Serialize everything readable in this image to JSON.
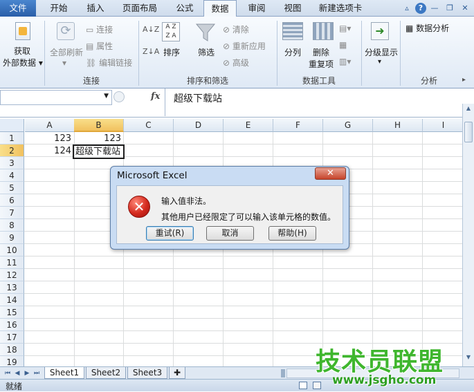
{
  "ribbon_tabs": [
    "文件",
    "开始",
    "插入",
    "页面布局",
    "公式",
    "数据",
    "审阅",
    "视图",
    "新建选项卡"
  ],
  "active_tab": "数据",
  "ribbon": {
    "get_external": [
      "获取",
      "外部数据"
    ],
    "refresh_all": "全部刷新",
    "connections": "连接",
    "properties": "属性",
    "edit_links": "编辑链接",
    "group_connections": "连接",
    "sort": "排序",
    "filter": "筛选",
    "clear": "清除",
    "reapply": "重新应用",
    "advanced": "高级",
    "group_sort_filter": "排序和筛选",
    "text_to_columns": "分列",
    "remove_dup": [
      "删除",
      "重复项"
    ],
    "group_data_tools": "数据工具",
    "outline": "分级显示",
    "data_analysis": "数据分析",
    "group_analysis": "分析"
  },
  "formula_bar": {
    "namebox": "",
    "fx": "fx",
    "value": "超级下载站"
  },
  "grid": {
    "columns": [
      "A",
      "B",
      "C",
      "D",
      "E",
      "F",
      "G",
      "H",
      "I"
    ],
    "rows": [
      "1",
      "2",
      "3",
      "4",
      "5",
      "6",
      "7",
      "8",
      "9",
      "10",
      "11",
      "12",
      "13",
      "14",
      "15",
      "16",
      "17",
      "18",
      "19"
    ],
    "cells": {
      "A1": "123",
      "B1": "123",
      "A2": "124",
      "B2": "超级下载站"
    },
    "selected_column": "B",
    "selected_row": "2"
  },
  "sheets": [
    "Sheet1",
    "Sheet2",
    "Sheet3"
  ],
  "active_sheet": "Sheet1",
  "status": "就绪",
  "dialog": {
    "title": "Microsoft Excel",
    "close": "✕",
    "message1": "输入值非法。",
    "message2": "其他用户已经限定了可以输入该单元格的数值。",
    "retry": "重试(R)",
    "cancel": "取消",
    "help": "帮助(H)"
  },
  "watermark": {
    "line1": "技术员联盟",
    "line2": "www.jsgho.com"
  }
}
